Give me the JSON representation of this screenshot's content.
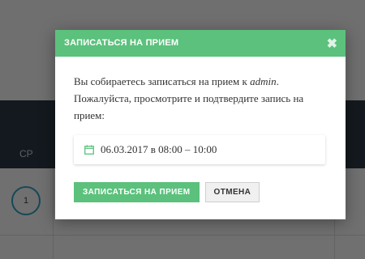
{
  "background": {
    "column_label": "СР",
    "day_number": "1"
  },
  "modal": {
    "title": "ЗАПИСАТЬСЯ НА ПРИЕМ",
    "close_symbol": "✖",
    "message_part1": "Вы собираетесь записаться на прием к ",
    "user": "admin",
    "message_part2": ". Пожалуйста, просмотрите и подтвердите запись на прием:",
    "appointment": "06.03.2017 в 08:00 – 10:00",
    "confirm_label": "ЗАПИСАТЬСЯ НА ПРИЕМ",
    "cancel_label": "ОТМЕНА"
  },
  "colors": {
    "accent": "#5bc17c",
    "calendar_header": "#2c3a46",
    "day_circle": "#33a5c4"
  },
  "icons": {
    "close": "close-icon",
    "calendar": "calendar-icon"
  }
}
